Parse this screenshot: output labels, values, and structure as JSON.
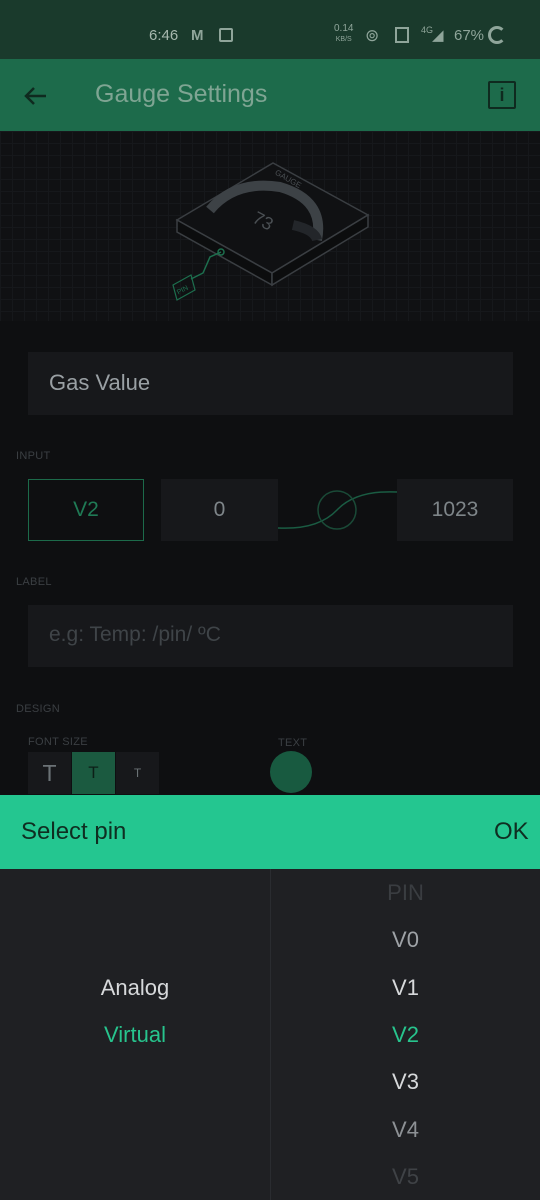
{
  "status_bar": {
    "time": "6:46",
    "speed": "0.14",
    "speed_unit": "KB/S",
    "battery": "67%",
    "network": "4G"
  },
  "header": {
    "title": "Gauge Settings"
  },
  "illustration": {
    "device_label": "GAUGE",
    "value": "73",
    "pin_label": "PIN"
  },
  "form": {
    "name_value": "Gas Value",
    "input_section": "INPUT",
    "pin_value": "V2",
    "min_value": "0",
    "max_value": "1023",
    "label_section": "LABEL",
    "label_placeholder": "e.g: Temp: /pin/ ºC",
    "design_section": "DESIGN",
    "font_size_label": "FONT SIZE",
    "text_label": "TEXT",
    "font_sizes": [
      "T",
      "T",
      "T"
    ]
  },
  "picker": {
    "title": "Select pin",
    "ok": "OK",
    "types": [
      "Analog",
      "Virtual"
    ],
    "pins": [
      "PIN",
      "V0",
      "V1",
      "V2",
      "V3",
      "V4",
      "V5"
    ],
    "selected_type": "Virtual",
    "selected_pin": "V2"
  },
  "colors": {
    "accent": "#24c690",
    "header": "#1d6b4b",
    "selected_text": "#27c48d"
  }
}
